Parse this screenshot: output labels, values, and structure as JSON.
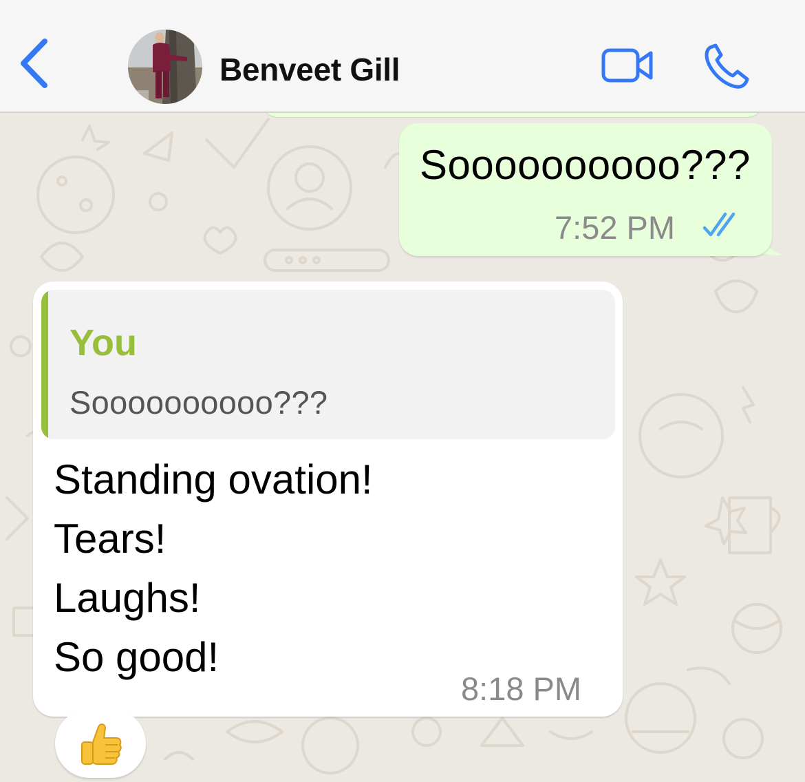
{
  "header": {
    "contact_name": "Benveet Gill",
    "back_icon": "chevron-left-icon",
    "video_icon": "video-camera-icon",
    "call_icon": "phone-icon",
    "accent_color": "#3478F6"
  },
  "messages": [
    {
      "direction": "outgoing",
      "text": "Soooooooooo???",
      "time": "7:52 PM",
      "status": "read",
      "status_icon": "double-check-icon",
      "bubble_color": "#E7FFDB"
    },
    {
      "direction": "incoming",
      "quote": {
        "author": "You",
        "text": "Soooooooooo???",
        "accent_color": "#97BF3C"
      },
      "lines": [
        "Standing ovation!",
        "Tears!",
        "Laughs!",
        "So good!"
      ],
      "time": "8:18 PM",
      "bubble_color": "#FFFFFF",
      "reaction": "thumbs-up-emoji"
    }
  ]
}
